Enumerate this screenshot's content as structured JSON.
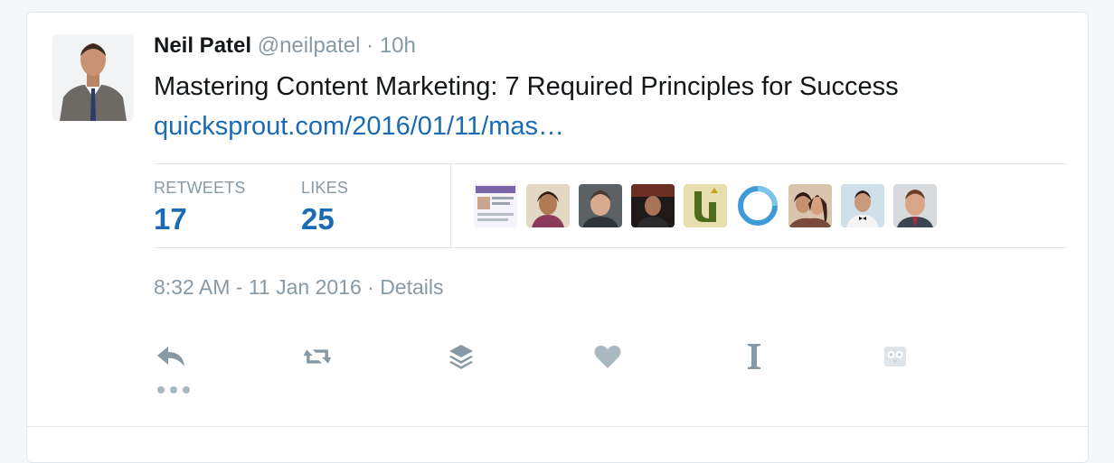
{
  "tweet": {
    "author_name": "Neil Patel",
    "author_handle": "@neilpatel",
    "separator": "·",
    "relative_time": "10h",
    "text": "Mastering Content Marketing: 7 Required Principles for Success",
    "link_text": "quicksprout.com/2016/01/11/mas…",
    "timestamp": "8:32 AM - 11 Jan 2016",
    "timestamp_separator": "·",
    "details_label": "Details"
  },
  "stats": {
    "retweets_label": "RETWEETS",
    "retweets_count": "17",
    "likes_label": "LIKES",
    "likes_count": "25"
  },
  "likers": [
    {
      "name": "liker-avatar-1",
      "bg": "#e9e6f2"
    },
    {
      "name": "liker-avatar-2",
      "bg": "#d9ccb7"
    },
    {
      "name": "liker-avatar-3",
      "bg": "#6b6f73"
    },
    {
      "name": "liker-avatar-4",
      "bg": "#2a2422"
    },
    {
      "name": "liker-avatar-5",
      "bg": "#c8b46a"
    },
    {
      "name": "liker-avatar-6",
      "bg": "#ffffff"
    },
    {
      "name": "liker-avatar-7",
      "bg": "#4a3a30"
    },
    {
      "name": "liker-avatar-8",
      "bg": "#dfe6ea"
    },
    {
      "name": "liker-avatar-9",
      "bg": "#d6dadc"
    }
  ],
  "actions": [
    "reply-icon",
    "retweet-icon",
    "buffer-icon",
    "like-icon",
    "instapaper-icon",
    "owl-icon",
    "more-icon"
  ],
  "colors": {
    "link": "#1b6bb4",
    "muted": "#8899a6",
    "icon": "#aab8c2",
    "text": "#14171a",
    "border": "#e1e8ed"
  }
}
